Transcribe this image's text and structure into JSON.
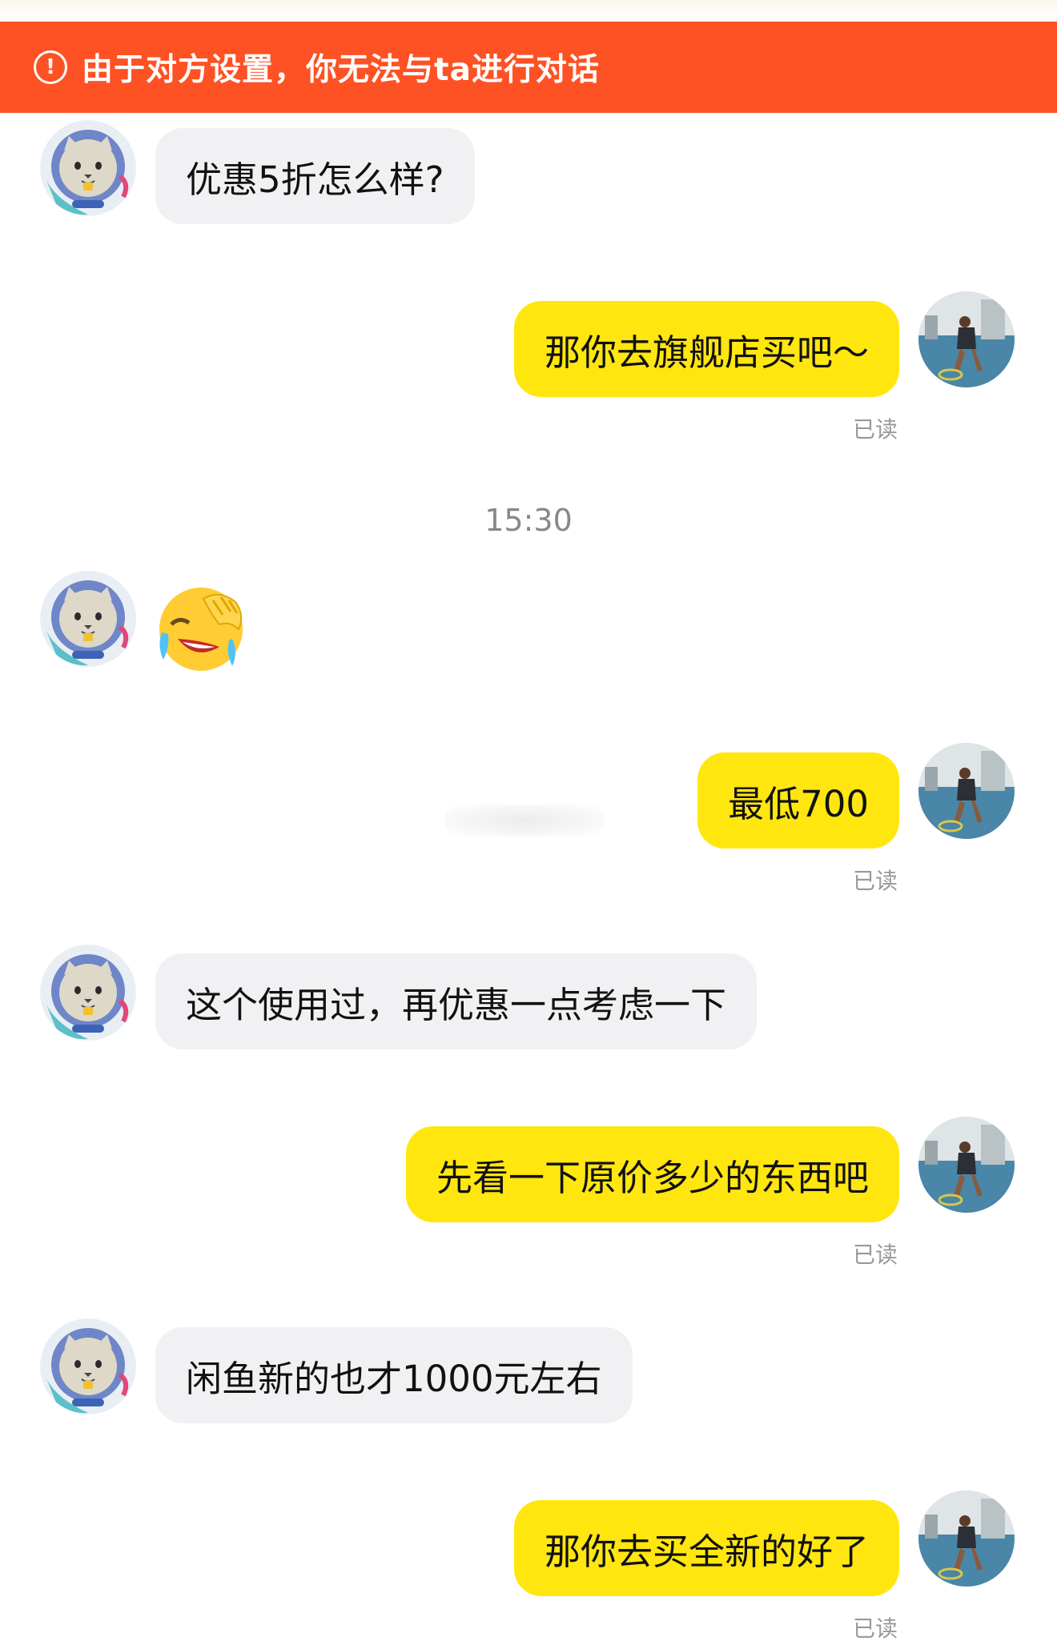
{
  "banner": {
    "text": "由于对方设置，你无法与ta进行对话",
    "icon": "alert-circle-icon",
    "color": "#fe5124"
  },
  "colors": {
    "incoming_bubble": "#f1f1f3",
    "outgoing_bubble": "#ffe60f",
    "read_text": "#999999"
  },
  "messages": [
    {
      "side": "in",
      "text": "优惠5折怎么样?"
    },
    {
      "side": "out",
      "text": "那你去旗舰店买吧～",
      "status": "已读"
    },
    {
      "side": "in",
      "emoji": "crying-laughing-emoji"
    },
    {
      "side": "out",
      "text": "最低700",
      "status": "已读"
    },
    {
      "side": "in",
      "text": "这个使用过，再优惠一点考虑一下"
    },
    {
      "side": "out",
      "text": "先看一下原价多少的东西吧",
      "status": "已读"
    },
    {
      "side": "in",
      "text": "闲鱼新的也才1000元左右"
    },
    {
      "side": "out",
      "text": "那你去买全新的好了",
      "status": "已读"
    }
  ],
  "timestamp": "15:30"
}
